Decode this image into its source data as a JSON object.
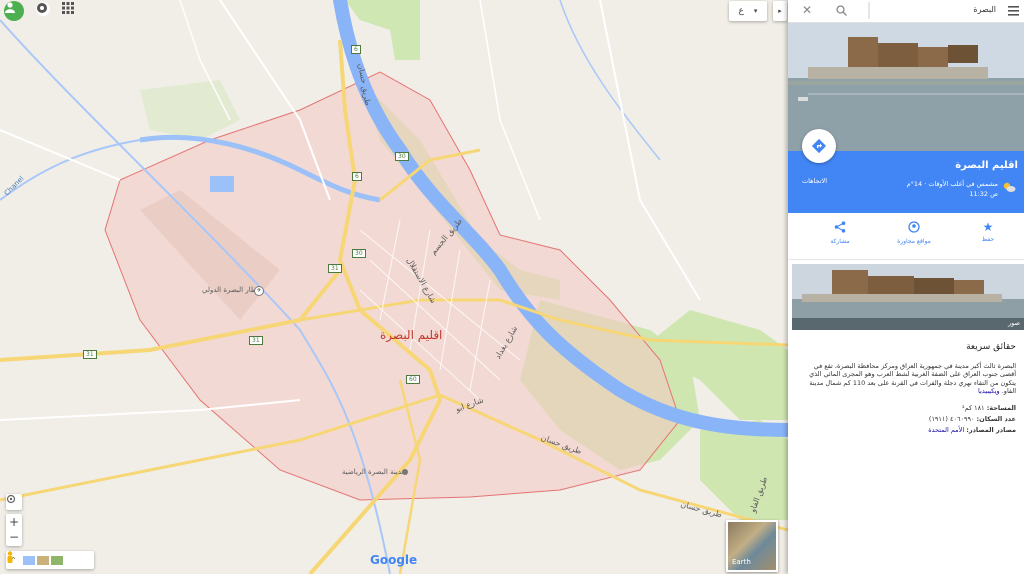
{
  "search": {
    "query": "البصرة"
  },
  "map": {
    "lang_toggle": "ع",
    "region_label": "اقليم البصرة",
    "airport_label": "مطار البصرة الدولي",
    "stadium_label": "مدينة البصرة الرياضية",
    "road_labels": {
      "r6_a": "6",
      "r6_b": "6",
      "r31_a": "31",
      "r31_b": "31",
      "r31_c": "31",
      "r30_a": "30",
      "r30_b": "30",
      "r60": "60",
      "street_a": "طريق حسان",
      "street_b": "طريق الجسم",
      "street_c": "شارع الاستقلال",
      "street_d": "شارع بغداد",
      "street_e": "شارع ابو",
      "street_f": "طريق حسان",
      "street_g": "طريق الفاو",
      "street_h": "طريق حسان"
    },
    "chanel": "Chanel",
    "brand": "Google",
    "earth_label": "Earth"
  },
  "place": {
    "title": "اقليم البصرة",
    "weather": "مشمس في أغلب الأوقات · 14°م",
    "time": "11:32 ص",
    "directions_label": "الاتجاهات"
  },
  "actions": {
    "save": "حفظ",
    "nearby": "مواقع مجاورة",
    "share": "مشاركة"
  },
  "photos_label": "صور",
  "facts": {
    "heading": "حقائق سريعة",
    "description": "البصرة ثالث أكبر مدينة في جمهورية العراق ومركز محافظة البصرة، تقع في أقصى جنوب العراق على الضفة الغربية لشط العرب وهو المجرى المائي الذي يتكون من التقاء نهري دجلة والفرات في القرنة على بعد 110 كم شمال مدينة الفاو.",
    "wiki": "ويكيبيديا",
    "area_key": "المساحة:",
    "area_val": "١٨١ كم²",
    "pop_key": "عدد السكان:",
    "pop_val": "٤٠٦٠٩٩٠ (١٩١١)",
    "sources_key": "مصادر المصادر:",
    "sources_val": "الأمم المتحدة"
  },
  "colors": {
    "accent": "#4285f4",
    "region_fill": "#f4c9c3",
    "region_stroke": "#e57373",
    "river": "#8ab4f8",
    "road_major": "#f7d676",
    "park": "#cbe6b0"
  }
}
